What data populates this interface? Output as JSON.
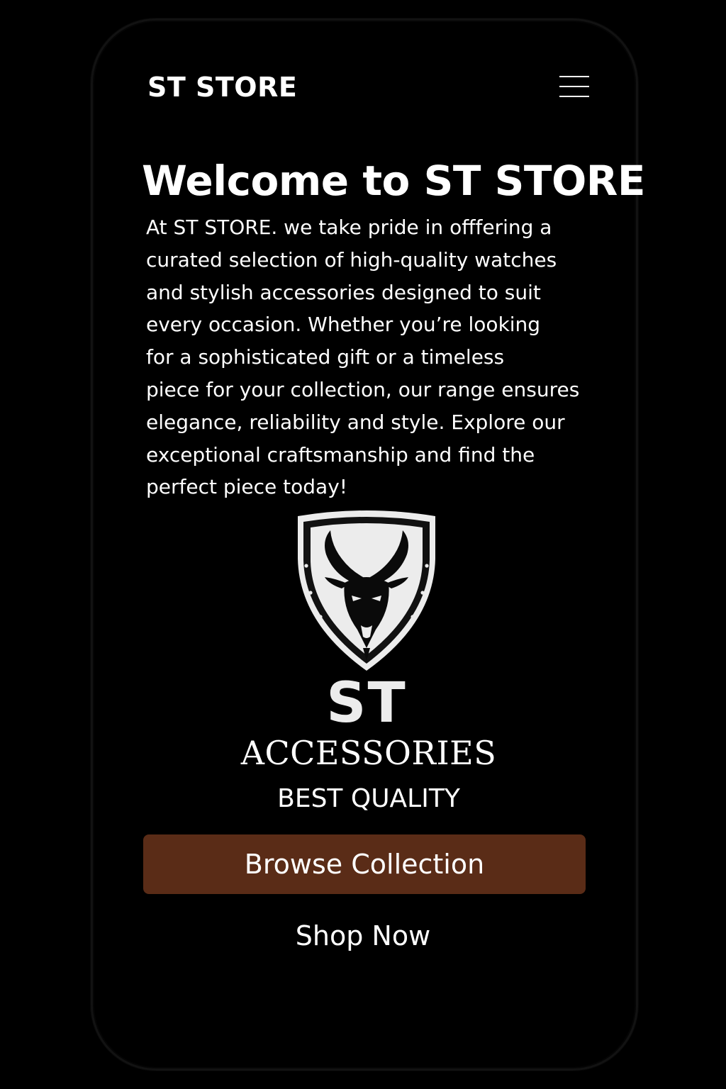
{
  "header": {
    "store_name": "ST STORE",
    "menu_icon": "hamburger-menu-icon"
  },
  "hero": {
    "title": "Welcome to ST STORE",
    "description_lines": [
      "At ST STORE. we take pride in offfering a",
      "curated selection of high-quality watches",
      "and stylish accessories designed to suit",
      "every occasion. Whether you’re looking",
      "for a sophisticated gift or a timeless",
      "piece for your collection, our range ensures",
      "elegance, reliability and style. Explore our",
      "exceptional craftsmanship and find the",
      "perfect piece today!"
    ]
  },
  "logo": {
    "emblem_icon": "goat-shield-emblem-icon",
    "monogram": "ST",
    "brand_line": "ACCESSORIES",
    "tagline": "BEST QUALITY"
  },
  "actions": {
    "browse_label": "Browse Collection",
    "shop_label": "Shop Now"
  },
  "colors": {
    "background": "#000000",
    "text": "#ffffff",
    "button": "#5a2c17",
    "emblem": "#ececec"
  }
}
